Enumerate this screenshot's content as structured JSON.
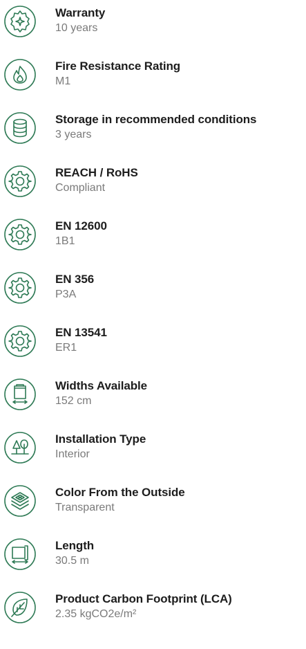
{
  "accent_color": "#2e7a55",
  "specs": [
    {
      "icon": "warranty-badge-icon",
      "label": "Warranty",
      "value": "10 years"
    },
    {
      "icon": "flame-icon",
      "label": "Fire Resistance Rating",
      "value": "M1"
    },
    {
      "icon": "database-icon",
      "label": "Storage in recommended conditions",
      "value": "3 years"
    },
    {
      "icon": "gear-icon",
      "label": "REACH / RoHS",
      "value": "Compliant"
    },
    {
      "icon": "gear-icon",
      "label": "EN 12600",
      "value": "1B1"
    },
    {
      "icon": "gear-icon",
      "label": "EN 356",
      "value": "P3A"
    },
    {
      "icon": "gear-icon",
      "label": "EN 13541",
      "value": "ER1"
    },
    {
      "icon": "roll-width-icon",
      "label": "Widths Available",
      "value": "152 cm"
    },
    {
      "icon": "interior-tree-icon",
      "label": "Installation Type",
      "value": "Interior"
    },
    {
      "icon": "layers-icon",
      "label": "Color From the Outside",
      "value": "Transparent"
    },
    {
      "icon": "roll-length-icon",
      "label": "Length",
      "value": "30.5 m"
    },
    {
      "icon": "leaf-icon",
      "label": "Product Carbon Footprint (LCA)",
      "value": "2.35 kgCO2e/m²"
    }
  ]
}
